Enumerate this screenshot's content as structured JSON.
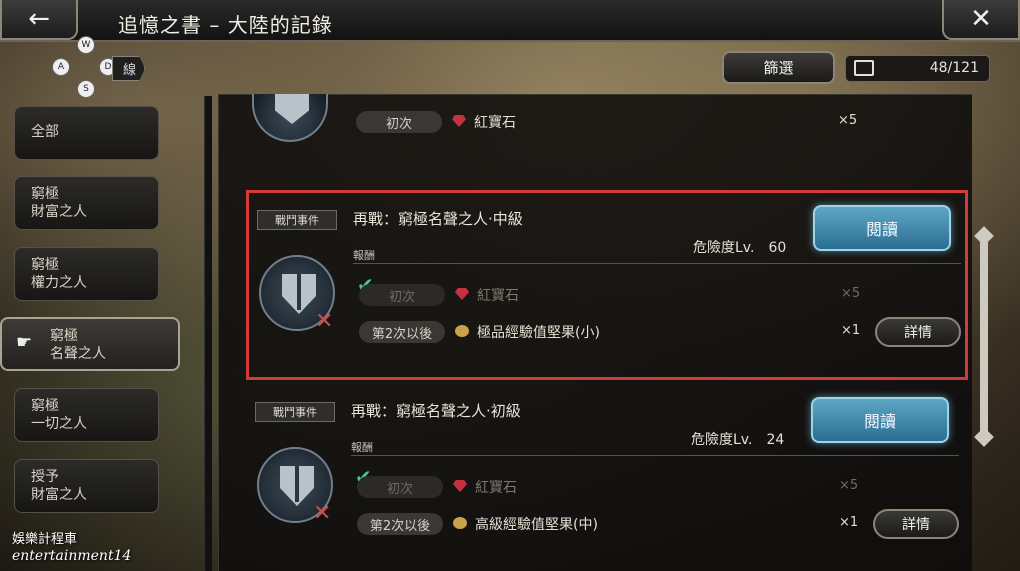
{
  "header": {
    "title": "追憶之書 – 大陸的記錄",
    "back_icon": "←",
    "close_icon": "✕"
  },
  "gamepad": {
    "buttons": [
      "W",
      "A",
      "D",
      "S"
    ],
    "tag": "線"
  },
  "toolbar": {
    "filter_label": "篩選",
    "counter": "48/121"
  },
  "sidebar": {
    "items": [
      {
        "label": "全部"
      },
      {
        "label": "窮極\n財富之人"
      },
      {
        "label": "窮極\n權力之人"
      },
      {
        "label": "窮極\n名聲之人"
      },
      {
        "label": "窮極\n一切之人"
      },
      {
        "label": "授予\n財富之人"
      }
    ],
    "active_index": 3
  },
  "partial_card": {
    "pill": "初次",
    "reward": "紅寶石",
    "qty": "×5"
  },
  "cards": [
    {
      "tag": "戰鬥事件",
      "title": "再戰：窮極名聲之人·中級",
      "reward_label": "報酬",
      "danger_label": "危險度Lv.",
      "danger_value": "60",
      "read_label": "閱讀",
      "first": {
        "pill": "初次",
        "reward": "紅寶石",
        "qty": "×5",
        "claimed": true
      },
      "repeat": {
        "pill": "第2次以後",
        "reward": "極品經驗值堅果(小)",
        "qty": "×1"
      },
      "detail_label": "詳情",
      "highlighted": true
    },
    {
      "tag": "戰鬥事件",
      "title": "再戰：窮極名聲之人·初級",
      "reward_label": "報酬",
      "danger_label": "危險度Lv.",
      "danger_value": "24",
      "read_label": "閱讀",
      "first": {
        "pill": "初次",
        "reward": "紅寶石",
        "qty": "×5",
        "claimed": true
      },
      "repeat": {
        "pill": "第2次以後",
        "reward": "高級經驗值堅果(中)",
        "qty": "×1"
      },
      "detail_label": "詳情",
      "highlighted": false
    }
  ],
  "watermark": {
    "line1": "娛樂計程車",
    "line2": "entertainment14"
  }
}
